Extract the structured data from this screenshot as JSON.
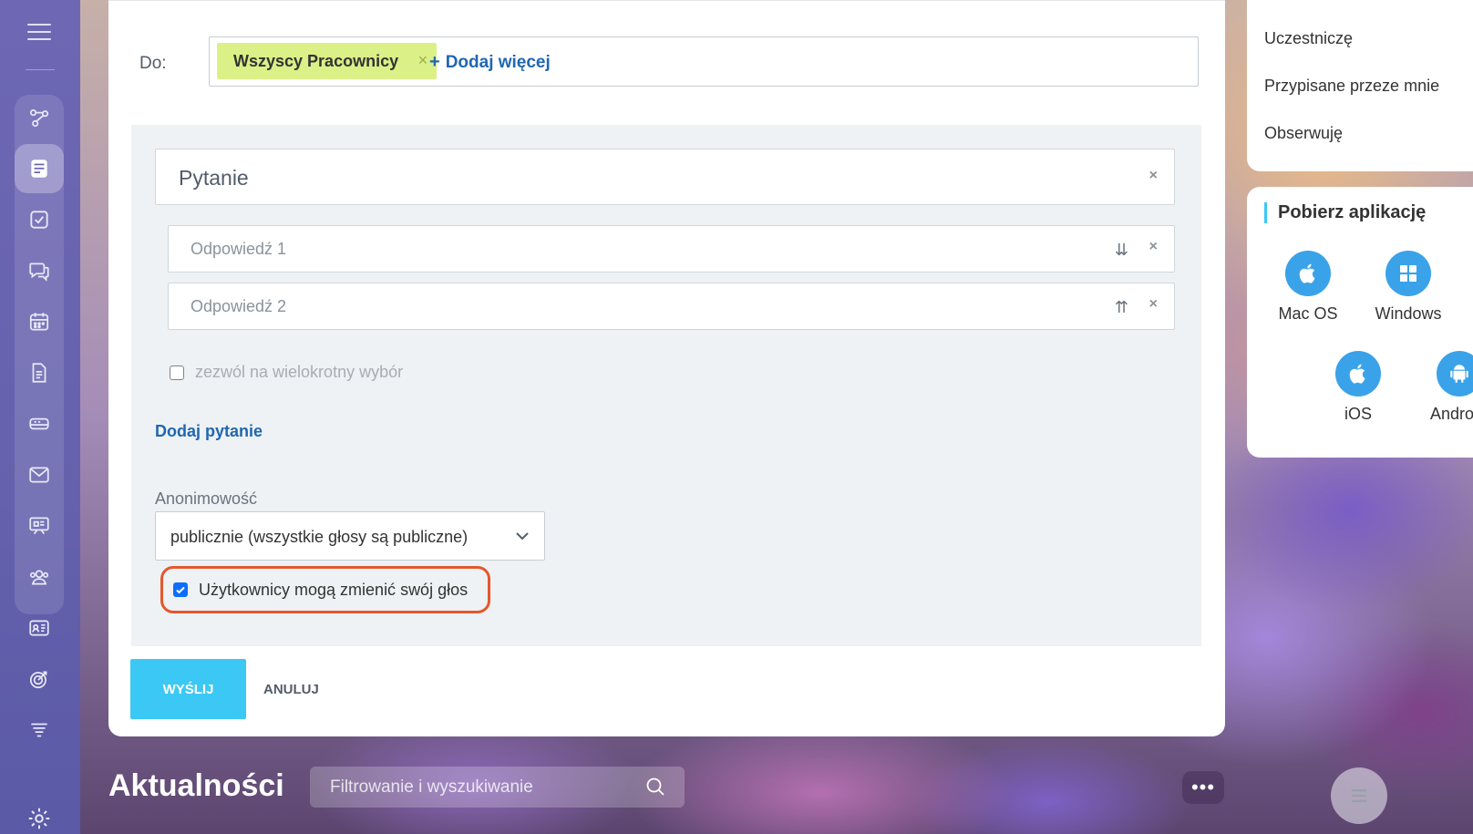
{
  "form": {
    "to_label": "Do:",
    "recipient_chip": "Wszyscy Pracownicy",
    "chip_remove": "×",
    "add_more": "Dodaj więcej",
    "add_more_plus": "+",
    "question_placeholder": "Pytanie",
    "answers": [
      {
        "placeholder": "Odpowiedź 1",
        "sort": "⇊"
      },
      {
        "placeholder": "Odpowiedź 2",
        "sort": "⇈"
      }
    ],
    "close": "×",
    "multi_choice_label": "zezwól na wielokrotny wybór",
    "multi_choice_checked": false,
    "add_question": "Dodaj pytanie",
    "anonymity_label": "Anonimowość",
    "anonymity_value": "publicznie (wszystkie głosy są publiczne)",
    "change_vote_label": "Użytkownicy mogą zmienić swój głos",
    "change_vote_checked": true,
    "send": "WYŚLIJ",
    "cancel": "ANULUJ"
  },
  "filters": {
    "items": [
      "Uczestniczę",
      "Przypisane przeze mnie",
      "Obserwuję"
    ]
  },
  "apps": {
    "title": "Pobierz aplikację",
    "items": [
      "Mac OS",
      "Windows",
      "iOS",
      "Android"
    ]
  },
  "bottom": {
    "page_title": "Aktualności",
    "search_placeholder": "Filtrowanie i wyszukiwanie",
    "more": "•••"
  },
  "colors": {
    "accent": "#3bc8f5",
    "link": "#2067b0",
    "chip": "#dbf087",
    "highlight": "#e4572e"
  }
}
